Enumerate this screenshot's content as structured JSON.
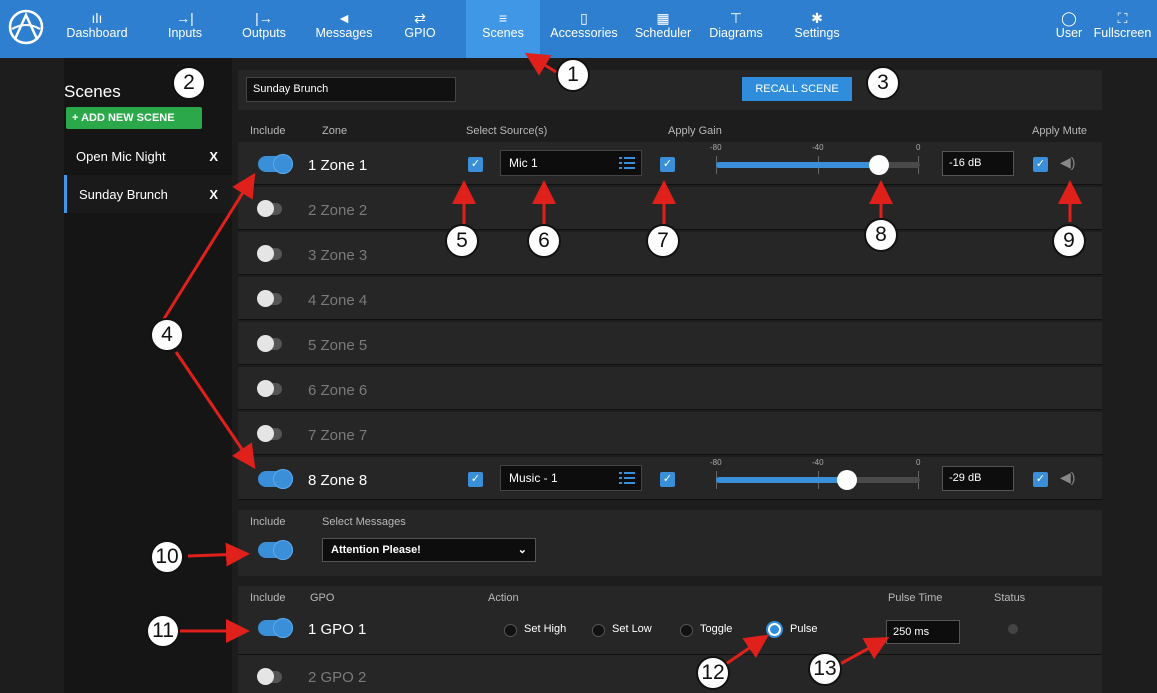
{
  "nav": {
    "items": [
      {
        "label": "Dashboard",
        "icon": "dashboard-icon",
        "glyph": "ılı"
      },
      {
        "label": "Inputs",
        "icon": "input-arrow-icon",
        "glyph": "→|"
      },
      {
        "label": "Outputs",
        "icon": "output-arrow-icon",
        "glyph": "|→"
      },
      {
        "label": "Messages",
        "icon": "megaphone-icon",
        "glyph": "◄"
      },
      {
        "label": "GPIO",
        "icon": "gpio-icon",
        "glyph": "⇄"
      },
      {
        "label": "Scenes",
        "icon": "scenes-icon",
        "glyph": "≡"
      },
      {
        "label": "Accessories",
        "icon": "phone-icon",
        "glyph": "▯"
      },
      {
        "label": "Scheduler",
        "icon": "calendar-icon",
        "glyph": "▦"
      },
      {
        "label": "Diagrams",
        "icon": "diagram-icon",
        "glyph": "⊤"
      },
      {
        "label": "Settings",
        "icon": "gear-icon",
        "glyph": "✱"
      }
    ],
    "active": "Scenes",
    "user_label": "User",
    "fullscreen_label": "Fullscreen"
  },
  "sidebar": {
    "title": "Scenes",
    "add_label": "+ ADD NEW SCENE",
    "scenes": [
      {
        "name": "Open Mic Night",
        "remove": "X"
      },
      {
        "name": "Sunday Brunch",
        "remove": "X"
      }
    ],
    "active_scene": "Sunday Brunch"
  },
  "scene": {
    "name": "Sunday Brunch",
    "recall_label": "RECALL SCENE"
  },
  "zones_header": {
    "include": "Include",
    "zone": "Zone",
    "source": "Select Source(s)",
    "gain": "Apply Gain",
    "mute": "Apply Mute"
  },
  "gain_scale": [
    "-80",
    "-40",
    "0"
  ],
  "zones": [
    {
      "label": "1 Zone 1",
      "included": true,
      "source": "Mic 1",
      "gain": "-16 dB",
      "gain_level": 0.8
    },
    {
      "label": "2 Zone 2",
      "included": false
    },
    {
      "label": "3 Zone 3",
      "included": false
    },
    {
      "label": "4 Zone 4",
      "included": false
    },
    {
      "label": "5 Zone 5",
      "included": false
    },
    {
      "label": "6 Zone 6",
      "included": false
    },
    {
      "label": "7 Zone 7",
      "included": false
    },
    {
      "label": "8 Zone 8",
      "included": true,
      "source": "Music - 1",
      "gain": "-29 dB",
      "gain_level": 0.64
    }
  ],
  "messages": {
    "include": "Include",
    "header": "Select Messages",
    "selected": "Attention Please!"
  },
  "gpio": {
    "include": "Include",
    "gpo_header": "GPO",
    "action_header": "Action",
    "pulse_header": "Pulse Time",
    "status_header": "Status",
    "rows": [
      {
        "label": "1 GPO 1",
        "included": true
      },
      {
        "label": "2 GPO 2",
        "included": false
      }
    ],
    "actions": [
      "Set High",
      "Set Low",
      "Toggle",
      "Pulse"
    ],
    "selected_action": "Pulse",
    "pulse_time": "250 ms"
  },
  "callouts": [
    "1",
    "2",
    "3",
    "4",
    "5",
    "6",
    "7",
    "8",
    "9",
    "10",
    "11",
    "12",
    "13"
  ],
  "colors": {
    "nav_bg": "#2f7fd0",
    "accent": "#3a8fd8",
    "add_green": "#2aa84a",
    "callout_arrow": "#e0201b"
  }
}
